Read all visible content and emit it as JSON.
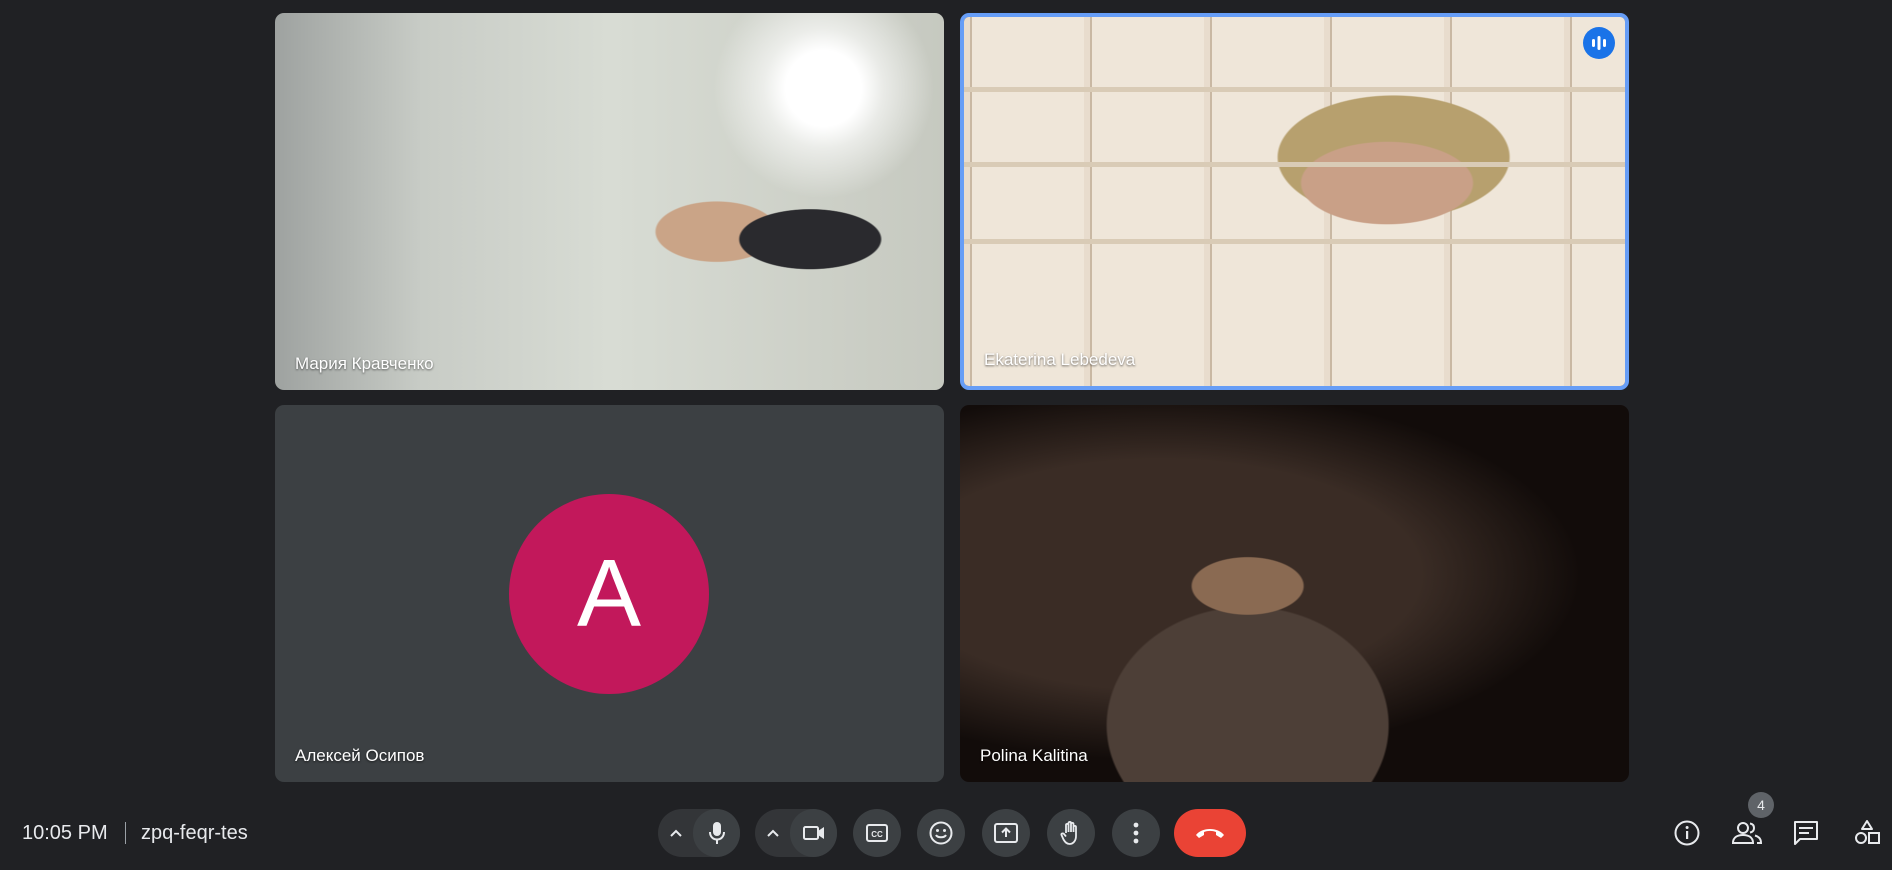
{
  "participants": [
    {
      "name": "Мария Кравченко",
      "has_video": true,
      "speaking": false
    },
    {
      "name": "Ekaterina Lebedeva",
      "has_video": true,
      "speaking": true
    },
    {
      "name": "Алексей Осипов",
      "has_video": false,
      "avatar_letter": "A",
      "avatar_color": "#c2185b",
      "speaking": false
    },
    {
      "name": "Polina Kalitina",
      "has_video": true,
      "speaking": false
    }
  ],
  "bottom_bar": {
    "time": "10:05 PM",
    "meeting_code": "zpq-feqr-tes",
    "participant_count": "4"
  },
  "controls": [
    {
      "name": "audio-options",
      "icon": "chevron-up-icon"
    },
    {
      "name": "microphone",
      "icon": "mic-icon"
    },
    {
      "name": "video-options",
      "icon": "chevron-up-icon"
    },
    {
      "name": "camera",
      "icon": "videocam-icon"
    },
    {
      "name": "captions",
      "icon": "closed-captions-icon"
    },
    {
      "name": "reactions",
      "icon": "emoji-icon"
    },
    {
      "name": "present",
      "icon": "present-screen-icon"
    },
    {
      "name": "raise-hand",
      "icon": "hand-icon"
    },
    {
      "name": "more-options",
      "icon": "more-vert-icon"
    },
    {
      "name": "leave-call",
      "icon": "call-end-icon"
    },
    {
      "name": "meeting-details",
      "icon": "info-icon"
    },
    {
      "name": "people",
      "icon": "people-icon"
    },
    {
      "name": "chat",
      "icon": "chat-icon"
    },
    {
      "name": "activities",
      "icon": "shapes-icon"
    }
  ],
  "colors": {
    "background": "#202124",
    "active_speaker_border": "#669df6",
    "hangup": "#ea4335",
    "speaking_badge": "#1a73e8"
  }
}
